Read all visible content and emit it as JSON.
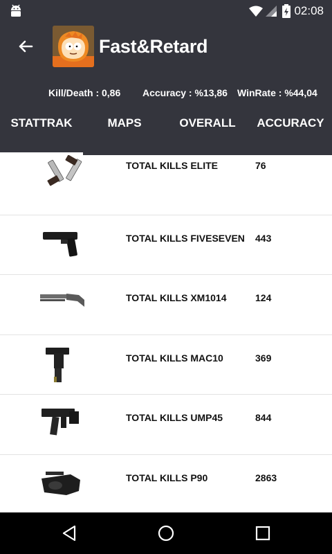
{
  "status_bar": {
    "time": "02:08",
    "icons": [
      "android-icon",
      "wifi-icon",
      "signal-icon",
      "battery-charging-icon"
    ]
  },
  "header": {
    "player_name": "Fast&Retard",
    "back_icon": "arrow-left-icon",
    "avatar": "cartoon-avatar"
  },
  "stats": {
    "kill_death": "Kill/Death : 0,86",
    "accuracy": "Accuracy : %13,86",
    "winrate": "WinRate : %44,04"
  },
  "tabs": [
    {
      "label": "STATTRAK",
      "selected": true
    },
    {
      "label": "MAPS",
      "selected": false
    },
    {
      "label": "OVERALL",
      "selected": false
    },
    {
      "label": "ACCURACY",
      "selected": false
    }
  ],
  "weapons": [
    {
      "label": "TOTAL KILLS ELITE",
      "value": "76",
      "icon": "dual-pistols-icon"
    },
    {
      "label": "TOTAL KILLS FIVESEVEN",
      "value": "443",
      "icon": "pistol-icon"
    },
    {
      "label": "TOTAL KILLS XM1014",
      "value": "124",
      "icon": "shotgun-icon"
    },
    {
      "label": "TOTAL KILLS MAC10",
      "value": "369",
      "icon": "smg-mac10-icon"
    },
    {
      "label": "TOTAL KILLS UMP45",
      "value": "844",
      "icon": "smg-ump45-icon"
    },
    {
      "label": "TOTAL KILLS P90",
      "value": "2863",
      "icon": "smg-p90-icon"
    }
  ],
  "navigation": [
    "back-icon",
    "home-icon",
    "recents-icon"
  ],
  "colors": {
    "app_bar": "#34353d",
    "tab_indicator": "#ffffff",
    "nav_bar": "#000000"
  }
}
